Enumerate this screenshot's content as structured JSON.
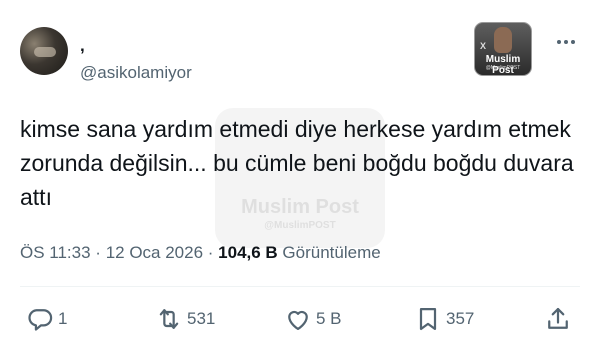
{
  "author": {
    "display_name": ",",
    "handle": "@asikolamiyor"
  },
  "badge": {
    "title": "Muslim Post",
    "subtitle": "@MuslimPOST",
    "x_mark": "X"
  },
  "tweet": {
    "text": "kimse sana yardım etmedi diye herkese yardım etmek zorunda değilsin... bu cümle beni boğdu boğdu duvara attı"
  },
  "watermark": {
    "title": "Muslim Post",
    "subtitle": "@MuslimPOST"
  },
  "meta": {
    "time": "ÖS 11:33",
    "separator1": " · ",
    "date": "12 Oca 2026",
    "separator2": " · ",
    "views_count": "104,6 B",
    "views_label": " Görüntüleme"
  },
  "actions": {
    "reply_count": "1",
    "repost_count": "531",
    "like_count": "5 B",
    "bookmark_count": "357"
  },
  "icons": {
    "more": "more-horizontal-icon",
    "reply": "reply-icon",
    "repost": "repost-icon",
    "like": "heart-icon",
    "bookmark": "bookmark-icon",
    "share": "share-icon"
  },
  "colors": {
    "text_primary": "#0f1419",
    "text_secondary": "#536471",
    "divider": "#eff3f4",
    "background": "#ffffff"
  }
}
